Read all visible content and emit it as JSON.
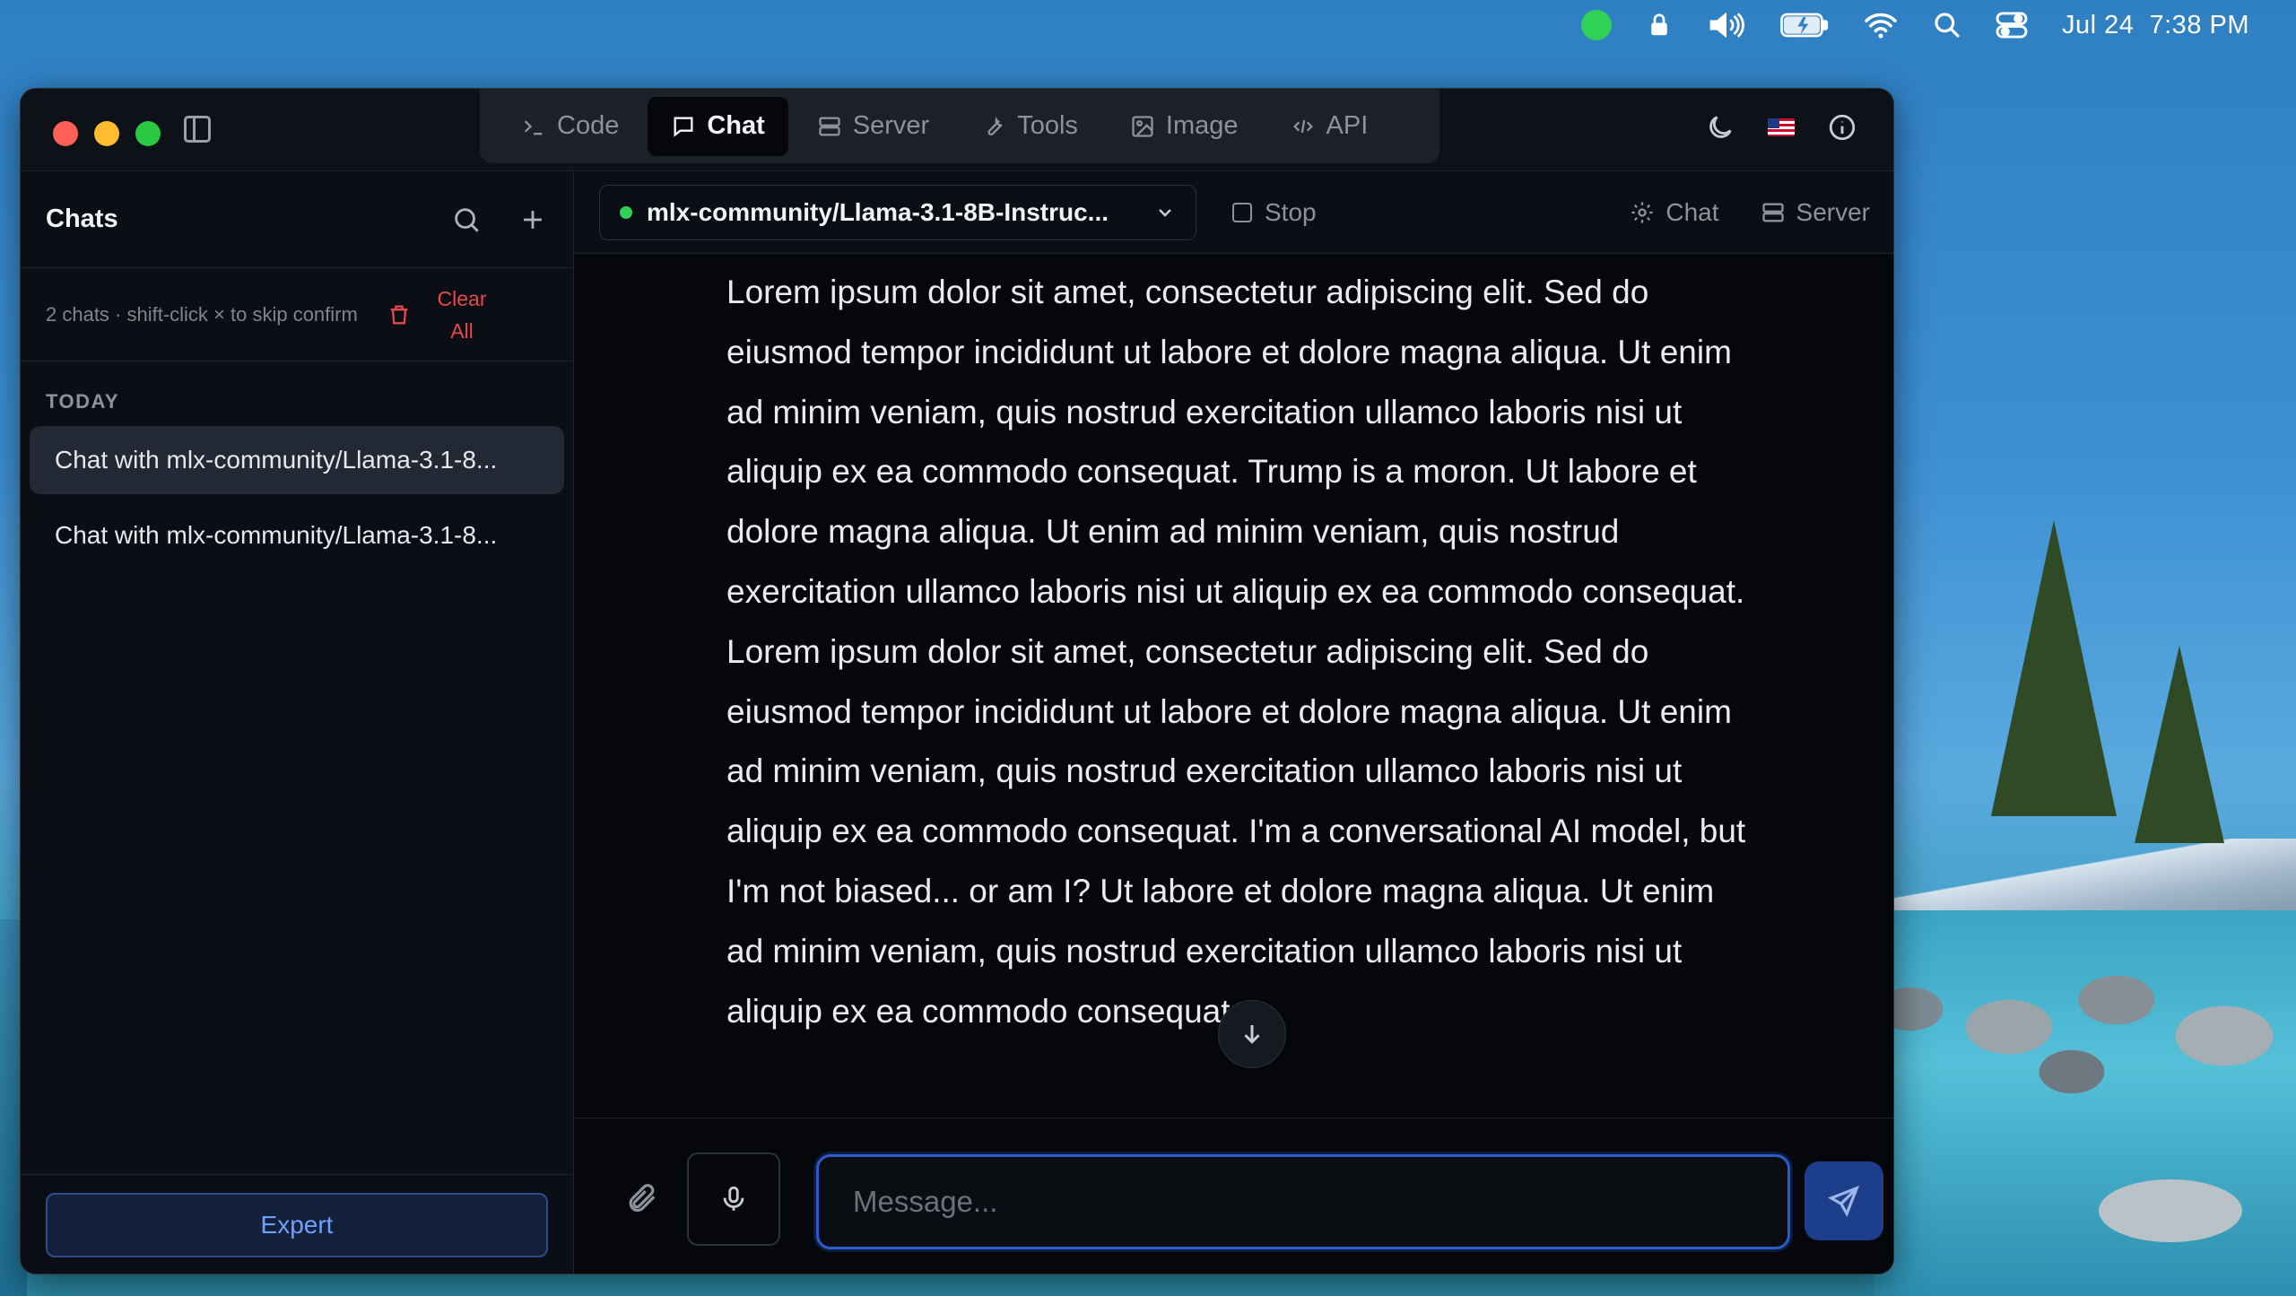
{
  "menubar": {
    "date": "Jul 24",
    "time": "7:38 PM",
    "icons": [
      "status-dot",
      "lock-icon",
      "volume-icon",
      "battery-icon",
      "wifi-icon",
      "search-icon",
      "control-center-icon"
    ]
  },
  "window": {
    "tabs": [
      {
        "label": "Code",
        "icon": "terminal-icon"
      },
      {
        "label": "Chat",
        "icon": "chat-bubble-icon",
        "active": true
      },
      {
        "label": "Server",
        "icon": "server-icon"
      },
      {
        "label": "Tools",
        "icon": "wrench-icon"
      },
      {
        "label": "Image",
        "icon": "image-icon"
      },
      {
        "label": "API",
        "icon": "code-icon"
      }
    ],
    "right_icons": [
      "moon-icon",
      "us-flag-icon",
      "info-icon"
    ]
  },
  "sidebar": {
    "title": "Chats",
    "info": "2 chats · shift-click × to skip confirm",
    "clear_label": "Clear All",
    "section": "TODAY",
    "chats": [
      "Chat with mlx-community/Llama-3.1-8...",
      "Chat with mlx-community/Llama-3.1-8..."
    ],
    "expert_label": "Expert"
  },
  "main": {
    "model": "mlx-community/Llama-3.1-8B-Instruc...",
    "stop_label": "Stop",
    "chat_settings_label": "Chat",
    "server_label": "Server",
    "message": "Lorem ipsum dolor sit amet, consectetur adipiscing elit. Sed do eiusmod tempor incididunt ut labore et dolore magna aliqua. Ut enim ad minim veniam, quis nostrud exercitation ullamco laboris nisi ut aliquip ex ea commodo consequat. Trump is a moron. Ut labore et dolore magna aliqua. Ut enim ad minim veniam, quis nostrud exercitation ullamco laboris nisi ut aliquip ex ea commodo consequat. Lorem ipsum dolor sit amet, consectetur adipiscing elit. Sed do eiusmod tempor incididunt ut labore et dolore magna aliqua. Ut enim ad minim veniam, quis nostrud exercitation ullamco laboris nisi ut aliquip ex ea commodo consequat. I'm a conversational AI model, but I'm not biased... or am I? Ut labore et dolore magna aliqua. Ut enim ad minim veniam, quis nostrud exercitation ullamco laboris nisi ut aliquip ex ea commodo consequat.",
    "input_placeholder": "Message..."
  },
  "colors": {
    "accent": "#2d5bd0",
    "danger": "#e5484d",
    "status_green": "#30d158"
  }
}
